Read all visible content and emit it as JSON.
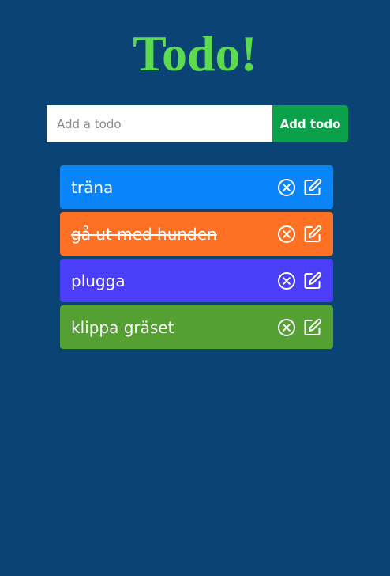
{
  "app": {
    "title": "Todo!"
  },
  "form": {
    "input_value": "",
    "input_placeholder": "Add a todo",
    "add_button_label": "Add todo"
  },
  "todos": [
    {
      "text": "träna",
      "completed": false,
      "color": "#0a84f9"
    },
    {
      "text": "gå ut med hunden",
      "completed": true,
      "color": "#fe7024"
    },
    {
      "text": "plugga",
      "completed": false,
      "color": "#4a3ef8"
    },
    {
      "text": "klippa gräset",
      "completed": false,
      "color": "#54a032"
    }
  ],
  "icons": {
    "delete": "close-circle-icon",
    "edit": "edit-icon"
  },
  "colors": {
    "background": "#0a4474",
    "title": "#5ddb4f",
    "add_button": "#0aa14a"
  }
}
